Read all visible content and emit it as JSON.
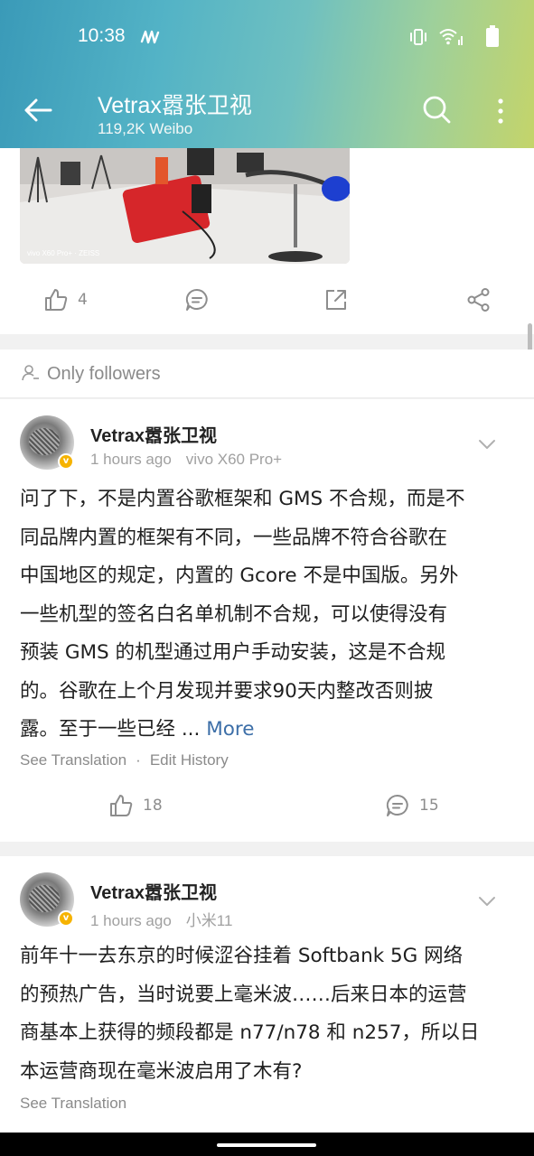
{
  "status_bar": {
    "time": "10:38"
  },
  "header": {
    "title": "Vetrax嚣张卫视",
    "subtitle": "119,2K Weibo"
  },
  "post1": {
    "photo_watermark": "vivo X60 Pro+ · ZEISS",
    "like_count": "4"
  },
  "visibility": {
    "label": "Only followers"
  },
  "post2": {
    "username": "Vetrax嚣张卫视",
    "time": "1 hours ago",
    "device": "vivo X60 Pro+",
    "lines": [
      "问了下，不是内置谷歌框架和 GMS 不合规，而是不",
      "同品牌内置的框架有不同，一些品牌不符合谷歌在",
      "中国地区的规定，内置的 Gcore 不是中国版。另外",
      "一些机型的签名白名单机制不合规，可以使得没有",
      "预装 GMS 的机型通过用户手动安装，这是不合规",
      "的。谷歌在上个月发现并要求90天内整改否则披",
      "露。至于一些已经 ... "
    ],
    "more_label": "More",
    "see_translation": "See Translation",
    "separator": "·",
    "edit_history": "Edit History",
    "like_count": "18",
    "comment_count": "15"
  },
  "post3": {
    "username": "Vetrax嚣张卫视",
    "time": "1 hours ago",
    "device": "小米11",
    "lines": [
      "前年十一去东京的时候涩谷挂着 Softbank 5G 网络",
      "的预热广告，当时说要上毫米波……后来日本的运营",
      "商基本上获得的频段都是 n77/n78 和 n257，所以日",
      "本运营商现在毫米波启用了木有?"
    ],
    "see_translation": "See Translation"
  },
  "icons": {
    "back": "arrow-left-icon",
    "search": "search-icon",
    "more": "more-vertical-icon",
    "like": "thumb-up-icon",
    "comment": "comment-icon",
    "repost": "repost-icon",
    "share": "share-icon",
    "visibility": "person-icon",
    "expand": "chevron-down-icon"
  },
  "colors": {
    "link": "#3d6fa8",
    "verified_badge": "#f6b300"
  }
}
